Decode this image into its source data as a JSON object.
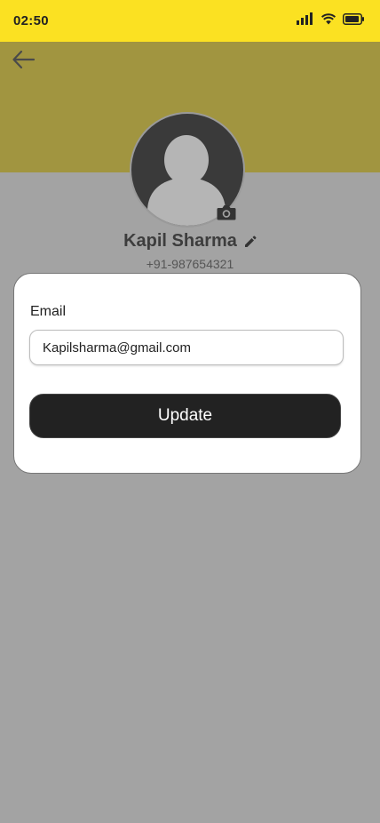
{
  "status_bar": {
    "time": "02:50",
    "icons": [
      "signal-icon",
      "wifi-icon",
      "battery-icon"
    ],
    "background": "#fbe122"
  },
  "header": {
    "back_icon": "arrow-left-icon",
    "background": "#a19540"
  },
  "profile": {
    "avatar_icon": "user-avatar-icon",
    "camera_icon": "camera-icon",
    "name": "Kapil Sharma",
    "edit_icon": "pencil-icon",
    "phone": "+91-987654321"
  },
  "form": {
    "email_label": "Email",
    "email_value": "Kapilsharma@gmail.com",
    "submit_label": "Update",
    "button_color": "#222222"
  }
}
